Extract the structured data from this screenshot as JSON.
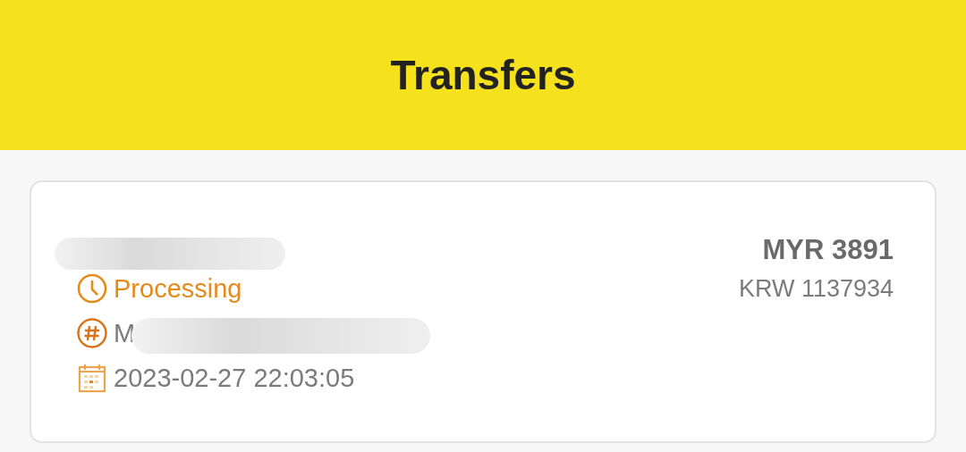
{
  "header": {
    "title": "Transfers"
  },
  "transfer": {
    "status": "Processing",
    "reference": "M",
    "date": "2023-02-27 22:03:05",
    "amount": "MYR 3891",
    "converted": "KRW 1137934"
  }
}
